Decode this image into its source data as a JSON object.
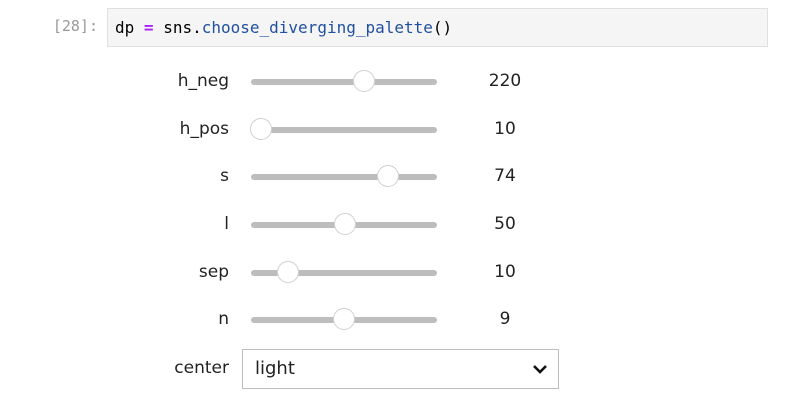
{
  "cell": {
    "prompt": "[28]:",
    "code": {
      "var": "dp",
      "op": "=",
      "obj": "sns.",
      "fn": "choose_diverging_palette",
      "paren": "()"
    }
  },
  "sliders": [
    {
      "label": "h_neg",
      "value": 220,
      "min": 0,
      "max": 359
    },
    {
      "label": "h_pos",
      "value": 10,
      "min": 0,
      "max": 359
    },
    {
      "label": "s",
      "value": 74,
      "min": 0,
      "max": 99
    },
    {
      "label": "l",
      "value": 50,
      "min": 0,
      "max": 99
    },
    {
      "label": "sep",
      "value": 10,
      "min": 1,
      "max": 50
    },
    {
      "label": "n",
      "value": 9,
      "min": 2,
      "max": 16
    }
  ],
  "center": {
    "label": "center",
    "selected": "light",
    "icon": "chevron-down-icon"
  }
}
